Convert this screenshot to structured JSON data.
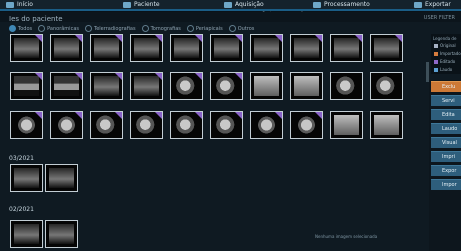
{
  "topbar": {
    "items": [
      "Início",
      "Paciente",
      "Aquisição",
      "Processamento",
      "Exportar"
    ],
    "capture_note": "Captura em execução"
  },
  "page": {
    "title": "Ies do paciente",
    "user": "USER FILTER"
  },
  "filters": {
    "options": [
      "Todos",
      "Panorâmicas",
      "Telerradiografias",
      "Tomografias",
      "Periapicais",
      "Outros"
    ],
    "selected": "Todos"
  },
  "grid": {
    "date_1": "03/2021",
    "date_2": "02/2021",
    "status": "Nenhuma imagem selecionada"
  },
  "legend": {
    "title": "Legenda de",
    "items": [
      {
        "label": "Original",
        "color": "#a7b2c4"
      },
      {
        "label": "Importado",
        "color": "#d57c3e"
      },
      {
        "label": "Editado",
        "color": "#8e69c9"
      },
      {
        "label": "Laudo",
        "color": "#5ca0d3"
      }
    ]
  },
  "sidebar": {
    "buttons": [
      "Exclu",
      "Servi",
      "Edita",
      "Laudo",
      "Visual",
      "Impri",
      "Expor",
      "Impor"
    ]
  }
}
